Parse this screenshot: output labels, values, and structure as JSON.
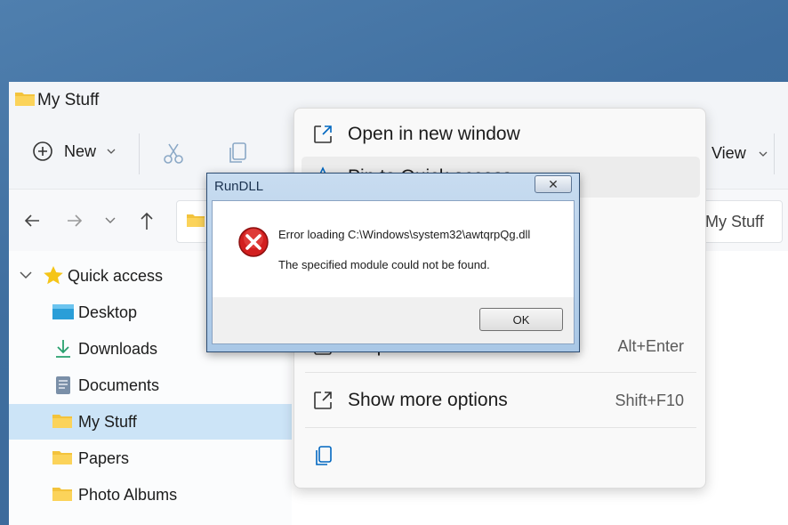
{
  "explorer": {
    "title": "My Stuff",
    "toolbar": {
      "new_label": "New",
      "view_label": "View"
    },
    "address": {
      "current": "My Stuff"
    },
    "nav": {
      "quick_access": "Quick access",
      "items": [
        "Desktop",
        "Downloads",
        "Documents",
        "My Stuff",
        "Papers",
        "Photo Albums"
      ],
      "selected": "My Stuff"
    }
  },
  "context_menu": {
    "items": [
      {
        "label": "Open in new window",
        "shortcut": ""
      },
      {
        "label": "Pin to Quick access",
        "shortcut": ""
      },
      {
        "label": "Properties",
        "shortcut": "Alt+Enter"
      },
      {
        "label": "Show more options",
        "shortcut": "Shift+F10"
      }
    ]
  },
  "dialog": {
    "title": "RunDLL",
    "close": "✕",
    "message_line1": "Error loading C:\\Windows\\system32\\awtqrpQg.dll",
    "message_line2": "The specified module could not be found.",
    "ok_label": "OK"
  },
  "colors": {
    "accent": "#0067c0",
    "selection": "#cce4f7",
    "error_red": "#d21f1f"
  }
}
